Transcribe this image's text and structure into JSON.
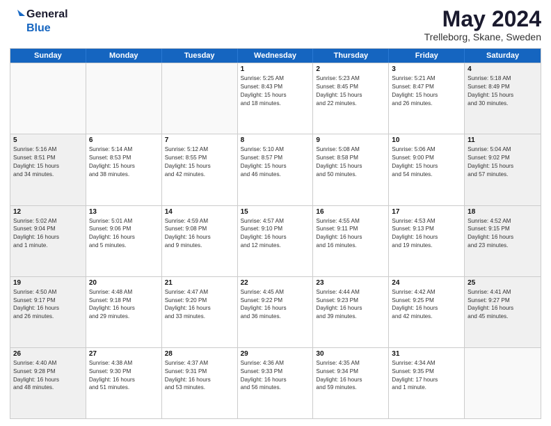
{
  "header": {
    "logo_line1": "General",
    "logo_line2": "Blue",
    "title": "May 2024",
    "subtitle": "Trelleborg, Skane, Sweden"
  },
  "weekdays": [
    "Sunday",
    "Monday",
    "Tuesday",
    "Wednesday",
    "Thursday",
    "Friday",
    "Saturday"
  ],
  "rows": [
    [
      {
        "day": "",
        "text": "",
        "empty": true
      },
      {
        "day": "",
        "text": "",
        "empty": true
      },
      {
        "day": "",
        "text": "",
        "empty": true
      },
      {
        "day": "1",
        "text": "Sunrise: 5:25 AM\nSunset: 8:43 PM\nDaylight: 15 hours\nand 18 minutes.",
        "empty": false
      },
      {
        "day": "2",
        "text": "Sunrise: 5:23 AM\nSunset: 8:45 PM\nDaylight: 15 hours\nand 22 minutes.",
        "empty": false
      },
      {
        "day": "3",
        "text": "Sunrise: 5:21 AM\nSunset: 8:47 PM\nDaylight: 15 hours\nand 26 minutes.",
        "empty": false
      },
      {
        "day": "4",
        "text": "Sunrise: 5:18 AM\nSunset: 8:49 PM\nDaylight: 15 hours\nand 30 minutes.",
        "empty": false,
        "shaded": true
      }
    ],
    [
      {
        "day": "5",
        "text": "Sunrise: 5:16 AM\nSunset: 8:51 PM\nDaylight: 15 hours\nand 34 minutes.",
        "empty": false,
        "shaded": true
      },
      {
        "day": "6",
        "text": "Sunrise: 5:14 AM\nSunset: 8:53 PM\nDaylight: 15 hours\nand 38 minutes.",
        "empty": false
      },
      {
        "day": "7",
        "text": "Sunrise: 5:12 AM\nSunset: 8:55 PM\nDaylight: 15 hours\nand 42 minutes.",
        "empty": false
      },
      {
        "day": "8",
        "text": "Sunrise: 5:10 AM\nSunset: 8:57 PM\nDaylight: 15 hours\nand 46 minutes.",
        "empty": false
      },
      {
        "day": "9",
        "text": "Sunrise: 5:08 AM\nSunset: 8:58 PM\nDaylight: 15 hours\nand 50 minutes.",
        "empty": false
      },
      {
        "day": "10",
        "text": "Sunrise: 5:06 AM\nSunset: 9:00 PM\nDaylight: 15 hours\nand 54 minutes.",
        "empty": false
      },
      {
        "day": "11",
        "text": "Sunrise: 5:04 AM\nSunset: 9:02 PM\nDaylight: 15 hours\nand 57 minutes.",
        "empty": false,
        "shaded": true
      }
    ],
    [
      {
        "day": "12",
        "text": "Sunrise: 5:02 AM\nSunset: 9:04 PM\nDaylight: 16 hours\nand 1 minute.",
        "empty": false,
        "shaded": true
      },
      {
        "day": "13",
        "text": "Sunrise: 5:01 AM\nSunset: 9:06 PM\nDaylight: 16 hours\nand 5 minutes.",
        "empty": false
      },
      {
        "day": "14",
        "text": "Sunrise: 4:59 AM\nSunset: 9:08 PM\nDaylight: 16 hours\nand 9 minutes.",
        "empty": false
      },
      {
        "day": "15",
        "text": "Sunrise: 4:57 AM\nSunset: 9:10 PM\nDaylight: 16 hours\nand 12 minutes.",
        "empty": false
      },
      {
        "day": "16",
        "text": "Sunrise: 4:55 AM\nSunset: 9:11 PM\nDaylight: 16 hours\nand 16 minutes.",
        "empty": false
      },
      {
        "day": "17",
        "text": "Sunrise: 4:53 AM\nSunset: 9:13 PM\nDaylight: 16 hours\nand 19 minutes.",
        "empty": false
      },
      {
        "day": "18",
        "text": "Sunrise: 4:52 AM\nSunset: 9:15 PM\nDaylight: 16 hours\nand 23 minutes.",
        "empty": false,
        "shaded": true
      }
    ],
    [
      {
        "day": "19",
        "text": "Sunrise: 4:50 AM\nSunset: 9:17 PM\nDaylight: 16 hours\nand 26 minutes.",
        "empty": false,
        "shaded": true
      },
      {
        "day": "20",
        "text": "Sunrise: 4:48 AM\nSunset: 9:18 PM\nDaylight: 16 hours\nand 29 minutes.",
        "empty": false
      },
      {
        "day": "21",
        "text": "Sunrise: 4:47 AM\nSunset: 9:20 PM\nDaylight: 16 hours\nand 33 minutes.",
        "empty": false
      },
      {
        "day": "22",
        "text": "Sunrise: 4:45 AM\nSunset: 9:22 PM\nDaylight: 16 hours\nand 36 minutes.",
        "empty": false
      },
      {
        "day": "23",
        "text": "Sunrise: 4:44 AM\nSunset: 9:23 PM\nDaylight: 16 hours\nand 39 minutes.",
        "empty": false
      },
      {
        "day": "24",
        "text": "Sunrise: 4:42 AM\nSunset: 9:25 PM\nDaylight: 16 hours\nand 42 minutes.",
        "empty": false
      },
      {
        "day": "25",
        "text": "Sunrise: 4:41 AM\nSunset: 9:27 PM\nDaylight: 16 hours\nand 45 minutes.",
        "empty": false,
        "shaded": true
      }
    ],
    [
      {
        "day": "26",
        "text": "Sunrise: 4:40 AM\nSunset: 9:28 PM\nDaylight: 16 hours\nand 48 minutes.",
        "empty": false,
        "shaded": true
      },
      {
        "day": "27",
        "text": "Sunrise: 4:38 AM\nSunset: 9:30 PM\nDaylight: 16 hours\nand 51 minutes.",
        "empty": false
      },
      {
        "day": "28",
        "text": "Sunrise: 4:37 AM\nSunset: 9:31 PM\nDaylight: 16 hours\nand 53 minutes.",
        "empty": false
      },
      {
        "day": "29",
        "text": "Sunrise: 4:36 AM\nSunset: 9:33 PM\nDaylight: 16 hours\nand 56 minutes.",
        "empty": false
      },
      {
        "day": "30",
        "text": "Sunrise: 4:35 AM\nSunset: 9:34 PM\nDaylight: 16 hours\nand 59 minutes.",
        "empty": false
      },
      {
        "day": "31",
        "text": "Sunrise: 4:34 AM\nSunset: 9:35 PM\nDaylight: 17 hours\nand 1 minute.",
        "empty": false
      },
      {
        "day": "",
        "text": "",
        "empty": true,
        "shaded": true
      }
    ]
  ]
}
